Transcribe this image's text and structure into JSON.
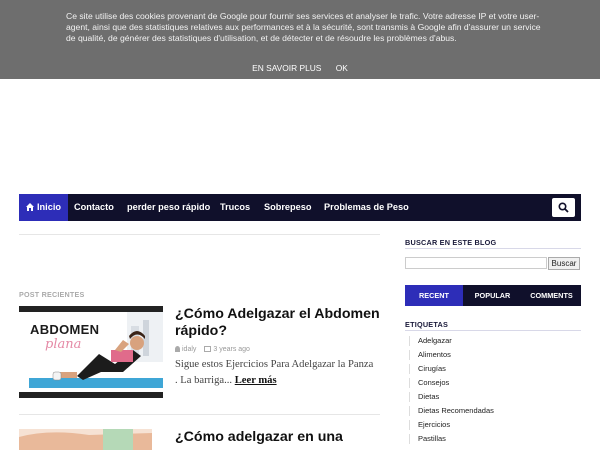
{
  "cookie": {
    "text": "Ce site utilise des cookies provenant de Google pour fournir ses services et analyser le trafic. Votre adresse IP et votre user-agent, ainsi que des statistiques relatives aux performances et à la sécurité, sont transmis à Google afin d'assurer un service de qualité, de générer des statistiques d'utilisation, et de détecter et de résoudre les problèmes d'abus.",
    "learn_more": "EN SAVOIR PLUS",
    "ok": "OK"
  },
  "nav": {
    "items": [
      {
        "label": "Inicio",
        "icon": "home-icon"
      },
      {
        "label": "Contacto"
      },
      {
        "label": "perder peso rápido"
      },
      {
        "label": "Trucos"
      },
      {
        "label": "Sobrepeso"
      },
      {
        "label": "Problemas de Peso"
      }
    ],
    "search_icon": "search-icon"
  },
  "main": {
    "section_label": "POST RECIENTES",
    "posts": [
      {
        "title": "¿Cómo Adelgazar el Abdomen rápido?",
        "author": "idaly",
        "date": "3 years ago",
        "excerpt": "Sigue estos  Ejercicios Para Adelgazar la Panza . La barriga...",
        "read_more": "Leer más",
        "thumb_text": "ABDOMEN",
        "thumb_script": "plana"
      },
      {
        "title": "¿Cómo adelgazar en una"
      }
    ]
  },
  "sidebar": {
    "search_title": "BUSCAR EN ESTE BLOG",
    "search_button": "Buscar",
    "tabs": [
      "RECENT",
      "POPULAR",
      "COMMENTS"
    ],
    "tags_title": "ETIQUETAS",
    "tags": [
      "Adelgazar",
      "Alimentos",
      "Cirugías",
      "Consejos",
      "Dietas",
      "Dietas Recomendadas",
      "Ejercicios",
      "Pastillas"
    ]
  },
  "colors": {
    "nav_bg": "#10102b",
    "accent": "#2d2db8",
    "cookie_bg": "#6e6e6e"
  }
}
